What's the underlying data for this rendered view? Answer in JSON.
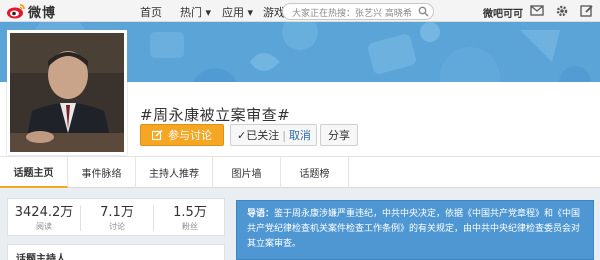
{
  "topbar": {
    "logo_text": "微博",
    "nav": [
      {
        "label": "首页"
      },
      {
        "label": "热门 ▾"
      },
      {
        "label": "应用 ▾"
      },
      {
        "label": "游戏 ▾"
      }
    ],
    "search_placeholder": "大家正在热搜：张艺兴 高晓希",
    "user_name": "微吧可可"
  },
  "topic": {
    "title": "#周永康被立案审查#",
    "join_label": "参与讨论",
    "followed_label": "✓已关注",
    "cancel_label": "取消",
    "share_label": "分享"
  },
  "tabs": [
    {
      "label": "话题主页",
      "active": true
    },
    {
      "label": "事件脉络",
      "active": false
    },
    {
      "label": "主持人推荐",
      "active": false
    },
    {
      "label": "图片墙",
      "active": false
    },
    {
      "label": "话题榜",
      "active": false
    }
  ],
  "stats": [
    {
      "value": "3424.2万",
      "label": "阅读"
    },
    {
      "value": "7.1万",
      "label": "讨论"
    },
    {
      "value": "1.5万",
      "label": "粉丝"
    }
  ],
  "host": {
    "label": "话题主持人"
  },
  "lead": {
    "label": "导语：",
    "text": "鉴于周永康涉嫌严重违纪，中共中央决定，依据《中国共产党章程》和《中国共产党纪律检查机关案件检查工作条例》的有关规定，由中共中央纪律检查委员会对其立案审查。"
  },
  "colors": {
    "accent": "#f5a623",
    "banner": "#5aa4d8",
    "lead_bg": "#4f97d2"
  }
}
